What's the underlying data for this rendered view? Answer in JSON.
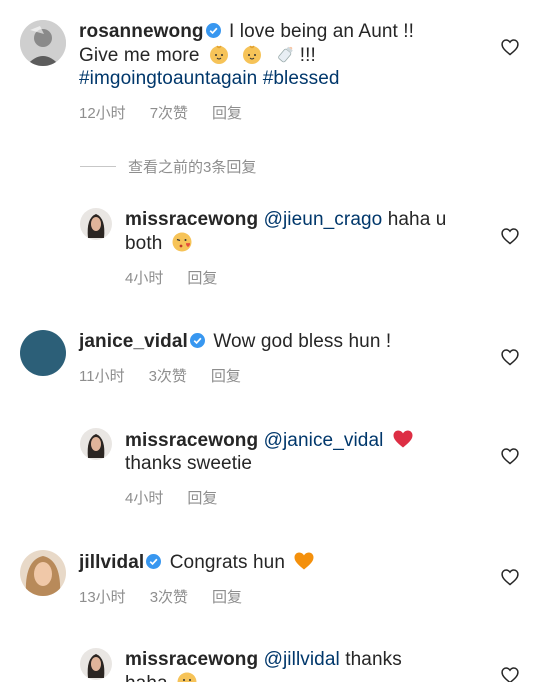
{
  "comments": [
    {
      "username": "rosannewong",
      "text_line1": "I love being an Aunt !!",
      "text_line2_start": "Give me more",
      "text_line2_end": "!!!",
      "hashtags": "#imgoingtoauntagain #blessed",
      "time": "12小时",
      "likes": "7次赞",
      "reply": "回复",
      "emojis": [
        "baby-face-emoji",
        "baby-face-emoji",
        "baby-bottle-emoji"
      ]
    },
    {
      "username": "janice_vidal",
      "text": "Wow god bless hun !",
      "time": "11小时",
      "likes": "3次赞",
      "reply": "回复",
      "avatar_color": "#2c5f78"
    },
    {
      "username": "jillvidal",
      "text": "Congrats hun",
      "time": "13小时",
      "likes": "3次赞",
      "reply": "回复",
      "emojis": [
        "orange-heart-emoji"
      ]
    }
  ],
  "view_previous": "查看之前的3条回复",
  "replies": [
    {
      "username": "missracewong",
      "mention": "@jieun_crago",
      "text_a": "haha u",
      "text_b": "both",
      "time": "4小时",
      "reply": "回复",
      "emojis": [
        "kissing-heart-emoji"
      ]
    },
    {
      "username": "missracewong",
      "mention": "@janice_vidal",
      "text_b": "thanks sweetie",
      "time": "4小时",
      "reply": "回复",
      "emojis": [
        "red-heart-emoji"
      ]
    },
    {
      "username": "missracewong",
      "mention": "@jillvidal",
      "text_a": "thanks",
      "text_b": "haha",
      "emojis": [
        "grinning-emoji"
      ]
    }
  ],
  "colors": {
    "verified": "#3897f0",
    "link": "#00376b",
    "meta": "#8e8e8e",
    "orange_heart": "#f4900c",
    "red_heart": "#dd2e44"
  }
}
